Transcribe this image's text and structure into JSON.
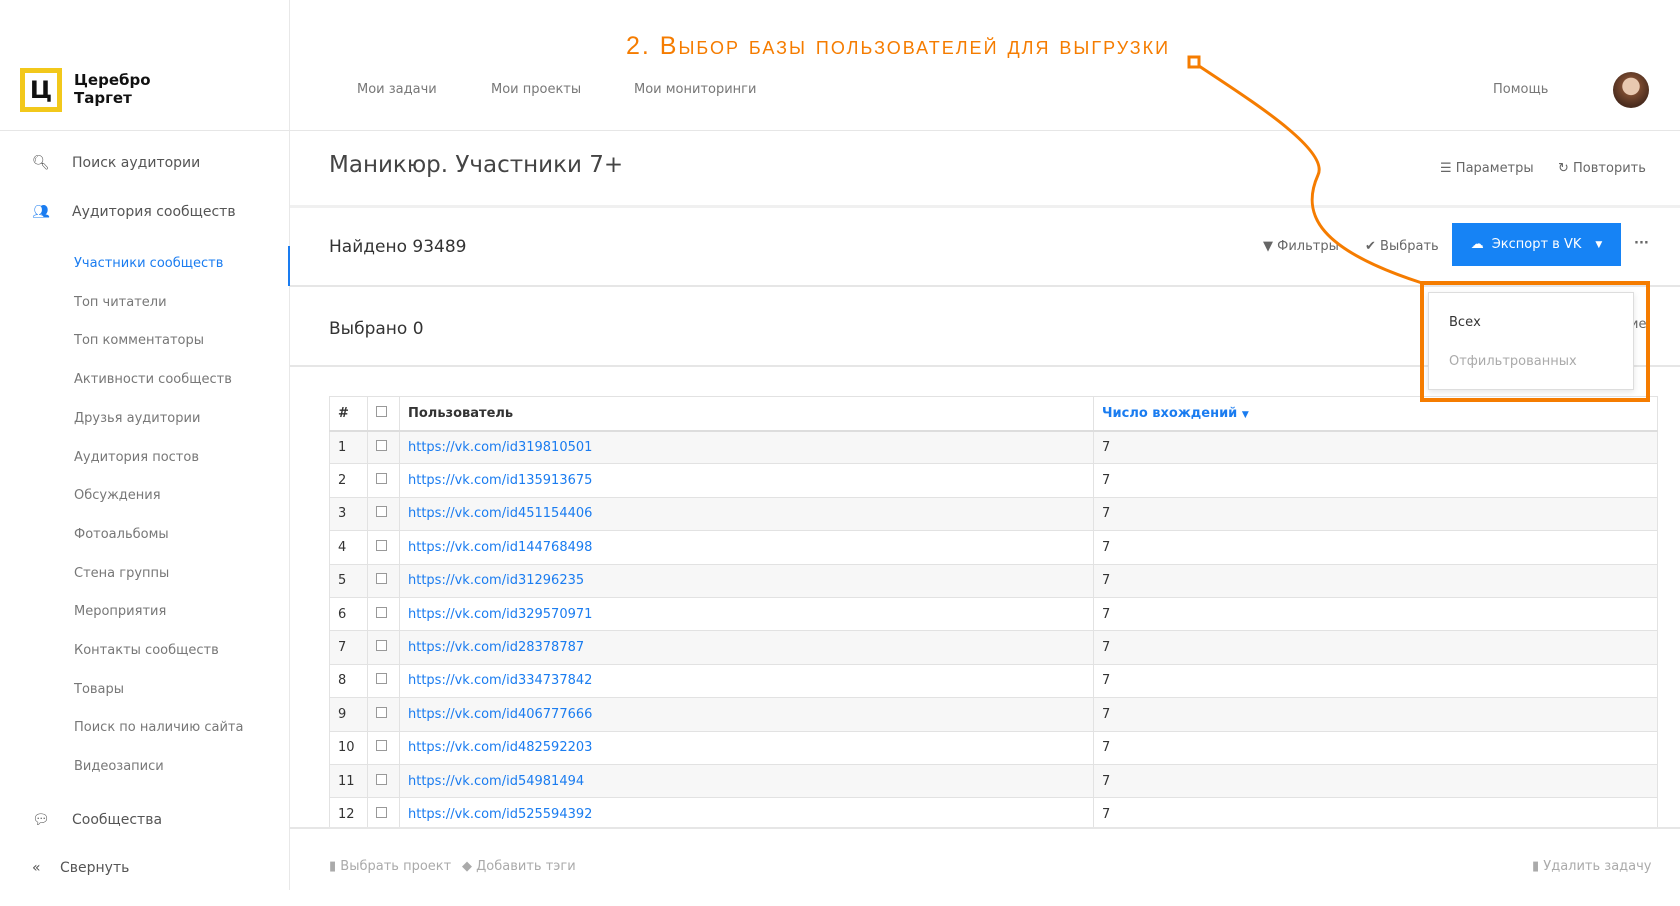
{
  "annotation": "2. Выбор базы пользователей для выгрузки",
  "logo": {
    "glyph": "Ц",
    "line1": "Церебро",
    "line2": "Таргет"
  },
  "topnav": {
    "items": [
      "Мои задачи",
      "Мои проекты",
      "Мои мониторинги"
    ],
    "help": "Помощь"
  },
  "sidebar": {
    "search": "Поиск аудитории",
    "communities_audience": "Аудитория сообществ",
    "sub": [
      "Участники сообществ",
      "Топ читатели",
      "Топ комментаторы",
      "Активности сообществ",
      "Друзья аудитории",
      "Аудитория постов",
      "Обсуждения",
      "Фотоальбомы",
      "Стена группы",
      "Мероприятия",
      "Контакты сообществ",
      "Товары",
      "Поиск по наличию сайта",
      "Видеозаписи"
    ],
    "communities": "Сообщества",
    "collapse": "Свернуть"
  },
  "page": {
    "title": "Маникюр. Участники 7+",
    "params": "Параметры",
    "repeat": "Повторить",
    "found": "Найдено 93489",
    "filters": "Фильтры",
    "select": "Выбрать",
    "export": "Экспорт в VK",
    "more": "···",
    "selected": "Выбрано 0"
  },
  "dropdown": {
    "all": "Всех",
    "filtered": "Отфильтрованных",
    "behind": "ие"
  },
  "table": {
    "headers": [
      "#",
      "Пользователь",
      "Число вхождений"
    ],
    "rows": [
      [
        "1",
        "https://vk.com/id319810501",
        "7"
      ],
      [
        "2",
        "https://vk.com/id135913675",
        "7"
      ],
      [
        "3",
        "https://vk.com/id451154406",
        "7"
      ],
      [
        "4",
        "https://vk.com/id144768498",
        "7"
      ],
      [
        "5",
        "https://vk.com/id31296235",
        "7"
      ],
      [
        "6",
        "https://vk.com/id329570971",
        "7"
      ],
      [
        "7",
        "https://vk.com/id28378787",
        "7"
      ],
      [
        "8",
        "https://vk.com/id334737842",
        "7"
      ],
      [
        "9",
        "https://vk.com/id406777666",
        "7"
      ],
      [
        "10",
        "https://vk.com/id482592203",
        "7"
      ],
      [
        "11",
        "https://vk.com/id54981494",
        "7"
      ],
      [
        "12",
        "https://vk.com/id525594392",
        "7"
      ]
    ]
  },
  "footer": {
    "choose_project": "Выбрать проект",
    "add_tags": "Добавить тэги",
    "delete_task": "Удалить задачу"
  },
  "colors": {
    "accent": "#1683f5",
    "annotation": "#f57c00",
    "logo": "#f2c81b"
  }
}
